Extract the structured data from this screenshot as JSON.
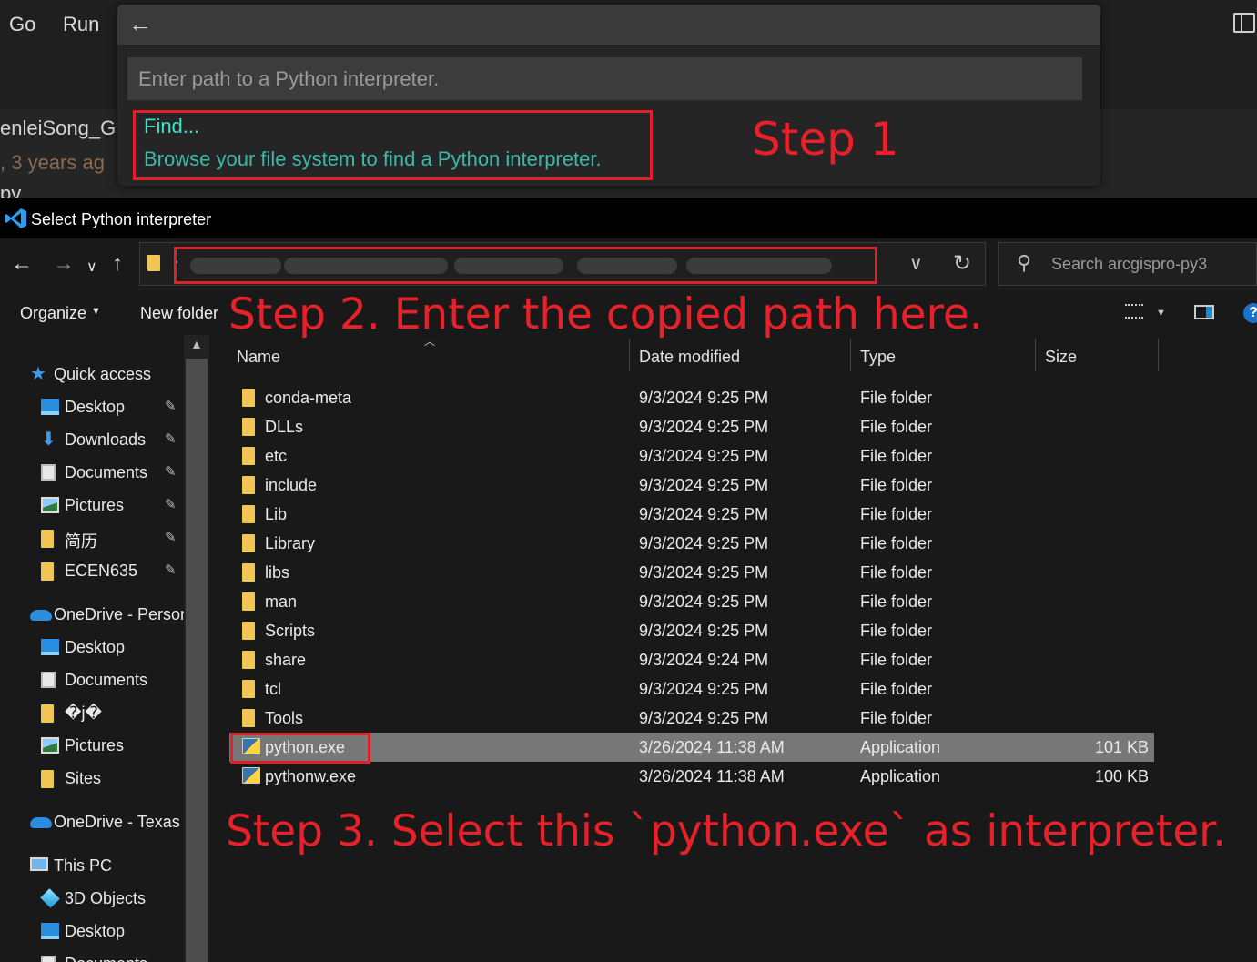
{
  "vscode": {
    "menu": [
      "Go",
      "Run"
    ],
    "behind": {
      "line1": "enleiSong_G",
      "line2": ", 3 years ag",
      "line3": "py"
    }
  },
  "quick_pick": {
    "placeholder": "Enter path to a Python interpreter.",
    "find_label": "Find...",
    "find_description": "Browse your file system to find a Python interpreter."
  },
  "dialog": {
    "title": "Select Python interpreter",
    "search_placeholder": "Search arcgispro-py3",
    "toolbar": {
      "organize": "Organize",
      "new_folder": "New folder"
    },
    "nav_pane": [
      {
        "label": "Quick access",
        "icon": "star-icon",
        "level": 0,
        "pinned": false
      },
      {
        "label": "Desktop",
        "icon": "desktop-icon",
        "level": 1,
        "pinned": true
      },
      {
        "label": "Downloads",
        "icon": "download-icon",
        "level": 1,
        "pinned": true
      },
      {
        "label": "Documents",
        "icon": "document-icon",
        "level": 1,
        "pinned": true
      },
      {
        "label": "Pictures",
        "icon": "pictures-icon",
        "level": 1,
        "pinned": true
      },
      {
        "label": "简历",
        "icon": "folder-icon",
        "level": 1,
        "pinned": true
      },
      {
        "label": "ECEN635",
        "icon": "folder-icon",
        "level": 1,
        "pinned": true
      },
      {
        "label": "OneDrive - Person",
        "icon": "onedrive-icon",
        "level": 0,
        "pinned": false
      },
      {
        "label": "Desktop",
        "icon": "desktop-icon",
        "level": 1,
        "pinned": false
      },
      {
        "label": "Documents",
        "icon": "document-icon",
        "level": 1,
        "pinned": false
      },
      {
        "label": "�j�",
        "icon": "folder-icon",
        "level": 1,
        "pinned": false
      },
      {
        "label": "Pictures",
        "icon": "pictures-icon",
        "level": 1,
        "pinned": false
      },
      {
        "label": "Sites",
        "icon": "folder-icon",
        "level": 1,
        "pinned": false
      },
      {
        "label": "OneDrive - Texas A",
        "icon": "onedrive-icon",
        "level": 0,
        "pinned": false
      },
      {
        "label": "This PC",
        "icon": "pc-icon",
        "level": 0,
        "pinned": false
      },
      {
        "label": "3D Objects",
        "icon": "3d-objects-icon",
        "level": 1,
        "pinned": false
      },
      {
        "label": "Desktop",
        "icon": "desktop-icon",
        "level": 1,
        "pinned": false
      },
      {
        "label": "Documents",
        "icon": "document-icon",
        "level": 1,
        "pinned": false
      }
    ],
    "columns": [
      "Name",
      "Date modified",
      "Type",
      "Size"
    ],
    "files": [
      {
        "name": "conda-meta",
        "date": "9/3/2024 9:25 PM",
        "type": "File folder",
        "size": "",
        "kind": "folder"
      },
      {
        "name": "DLLs",
        "date": "9/3/2024 9:25 PM",
        "type": "File folder",
        "size": "",
        "kind": "folder"
      },
      {
        "name": "etc",
        "date": "9/3/2024 9:25 PM",
        "type": "File folder",
        "size": "",
        "kind": "folder"
      },
      {
        "name": "include",
        "date": "9/3/2024 9:25 PM",
        "type": "File folder",
        "size": "",
        "kind": "folder"
      },
      {
        "name": "Lib",
        "date": "9/3/2024 9:25 PM",
        "type": "File folder",
        "size": "",
        "kind": "folder"
      },
      {
        "name": "Library",
        "date": "9/3/2024 9:25 PM",
        "type": "File folder",
        "size": "",
        "kind": "folder"
      },
      {
        "name": "libs",
        "date": "9/3/2024 9:25 PM",
        "type": "File folder",
        "size": "",
        "kind": "folder"
      },
      {
        "name": "man",
        "date": "9/3/2024 9:25 PM",
        "type": "File folder",
        "size": "",
        "kind": "folder"
      },
      {
        "name": "Scripts",
        "date": "9/3/2024 9:25 PM",
        "type": "File folder",
        "size": "",
        "kind": "folder"
      },
      {
        "name": "share",
        "date": "9/3/2024 9:24 PM",
        "type": "File folder",
        "size": "",
        "kind": "folder"
      },
      {
        "name": "tcl",
        "date": "9/3/2024 9:25 PM",
        "type": "File folder",
        "size": "",
        "kind": "folder"
      },
      {
        "name": "Tools",
        "date": "9/3/2024 9:25 PM",
        "type": "File folder",
        "size": "",
        "kind": "folder"
      },
      {
        "name": "python.exe",
        "date": "3/26/2024 11:38 AM",
        "type": "Application",
        "size": "101 KB",
        "kind": "exe",
        "selected": true
      },
      {
        "name": "pythonw.exe",
        "date": "3/26/2024 11:38 AM",
        "type": "Application",
        "size": "100 KB",
        "kind": "exe"
      }
    ]
  },
  "annotations": {
    "step1": "Step 1",
    "step2": "Step 2. Enter the copied path here.",
    "step3": "Step 3. Select this `python.exe` as interpreter."
  },
  "colors": {
    "annotation_red": "#e0202a",
    "find_teal": "#3ee0ca",
    "selected_row": "#777777"
  }
}
